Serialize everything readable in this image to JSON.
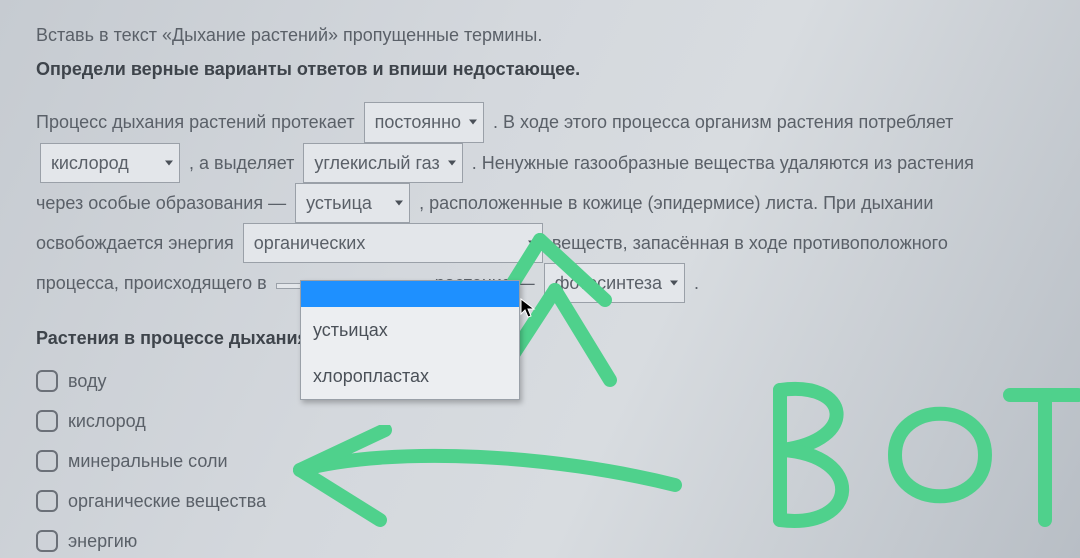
{
  "intro": {
    "line1": "Вставь в текст «Дыхание растений» пропущенные термины.",
    "line2": "Определи верные варианты ответов и впиши недостающее."
  },
  "passage": {
    "t1": "Процесс дыхания растений протекает",
    "sel1": "постоянно",
    "t2": ". В ходе этого процесса организм растения потребляет",
    "sel2": "кислород",
    "t3": ", а выделяет",
    "sel3": "углекислый газ",
    "t4": ". Ненужные газообразные вещества удаляются из растения",
    "t5": "через особые образования —",
    "sel4": "устьица",
    "t6": ", расположенные в кожице (эпидермисе) листа. При дыхании",
    "t7": "освобождается энергия",
    "sel5": "органических",
    "t8": "веществ, запасённая в ходе противоположного",
    "t9": "процесса, происходящего в",
    "sel6": "",
    "t10": "растения —",
    "sel7": "фотосинтеза",
    "t11": "."
  },
  "dropdown": {
    "selected_blank": "",
    "opt1": "устьицах",
    "opt2": "хлоропластах"
  },
  "question2": "Растения в процессе дыхания выделяют",
  "checkboxes": [
    {
      "label": "воду"
    },
    {
      "label": "кислород"
    },
    {
      "label": "минеральные соли"
    },
    {
      "label": "органические вещества"
    },
    {
      "label": "энергию"
    }
  ],
  "annotation_text": "ВОТ"
}
